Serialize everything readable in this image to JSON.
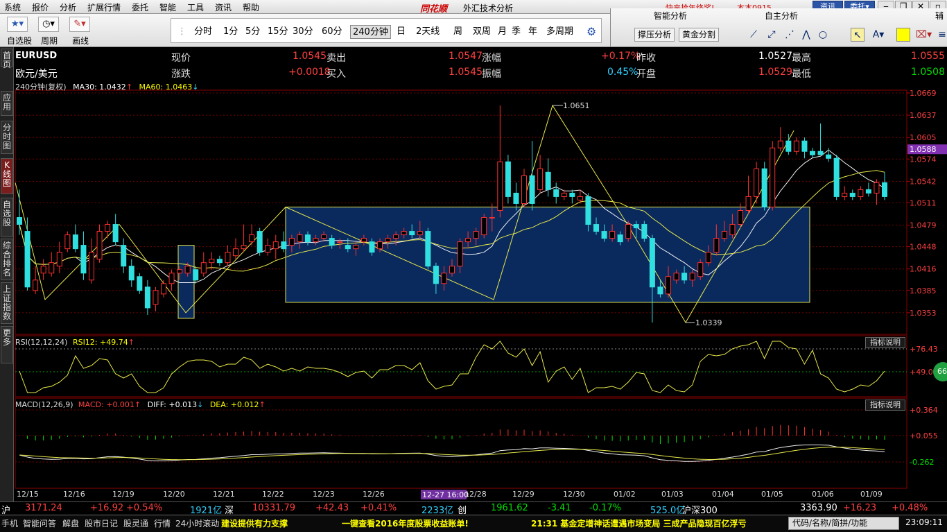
{
  "menu": [
    "系统",
    "报价",
    "分析",
    "扩展行情",
    "委托",
    "智能",
    "工具",
    "资讯",
    "帮助"
  ],
  "brand": "同花顺",
  "app_title": "外汇技术分析",
  "promo": "快来拾年终奖!",
  "user": "本本0915",
  "top_buttons": {
    "news": "资讯",
    "trade": "委托▾"
  },
  "toolbar": {
    "selfselect": "自选股",
    "period": "周期",
    "draw": "画线"
  },
  "periods": [
    "分时",
    "1分",
    "5分",
    "15分",
    "30分",
    "60分",
    "240分钟",
    "日",
    "2天线",
    "周",
    "双周",
    "月",
    "季",
    "年",
    "多周期"
  ],
  "active_period": "240分钟",
  "right_panel": {
    "smart": "智能分析",
    "self": "自主分析",
    "assist": "辅",
    "support": "撑压分析",
    "golden": "黄金分割"
  },
  "sidebar": [
    "首页",
    "应用",
    "分时图",
    "K线图",
    "自选股",
    "综合排名",
    "上证指数",
    "更多"
  ],
  "quote": {
    "code": "EURUSD",
    "name": "欧元/美元",
    "price_label": "现价",
    "price": "1.0545",
    "sell_label": "卖出",
    "sell": "1.0547",
    "pct_label": "涨幅",
    "pct": "+0.17%",
    "prevclose_label": "昨收",
    "prevclose": "1.0527",
    "high_label": "最高",
    "high": "1.0555",
    "change_label": "涨跌",
    "change": "+0.0018",
    "buy_label": "买入",
    "buy": "1.0545",
    "amp_label": "振幅",
    "amp": "0.45%",
    "open_label": "开盘",
    "open": "1.0529",
    "low_label": "最低",
    "low": "1.0508"
  },
  "ma_line": {
    "period": "240分钟(复权)",
    "ma30": "MA30: 1.0432",
    "ma60": "MA60: 1.0463"
  },
  "rsi_line": {
    "name": "RSI(12,12,24)",
    "val": "RSI12: +49.74"
  },
  "macd_line": {
    "name": "MACD(12,26,9)",
    "macd": "MACD: +0.001",
    "diff": "DIFF: +0.013",
    "dea": "DEA: +0.012"
  },
  "indicator_btn": "指标说明",
  "rsi_badge": "66",
  "chart_data": {
    "type": "candlestick",
    "price_axis": [
      "1.0669",
      "1.0637",
      "1.0605",
      "1.0574",
      "1.0542",
      "1.0511",
      "1.0479",
      "1.0448",
      "1.0416",
      "1.0385",
      "1.0353"
    ],
    "current_price": "1.0588",
    "annotations": {
      "high": "1.0651",
      "low": "1.0339"
    },
    "ylim": [
      1.0322,
      1.0669
    ],
    "rsi_axis": [
      "76.43",
      "49.02"
    ],
    "macd_axis": [
      "0.364",
      "0.055",
      "-0.262"
    ],
    "dates": [
      "12/15",
      "12/16",
      "12/19",
      "12/20",
      "12/21",
      "12/22",
      "12/23",
      "12/26",
      "12/28",
      "12/29",
      "12/30",
      "01/02",
      "01/03",
      "01/04",
      "01/05",
      "01/06",
      "01/09"
    ],
    "cursor_date": "12-27 16:00",
    "candles": [
      [
        1.049,
        1.048,
        1.053,
        1.0465
      ],
      [
        1.047,
        1.039,
        1.049,
        1.0385
      ],
      [
        1.0385,
        1.04,
        1.042,
        1.038
      ],
      [
        1.041,
        1.042,
        1.043,
        1.04
      ],
      [
        1.041,
        1.0425,
        1.044,
        1.0405
      ],
      [
        1.042,
        1.044,
        1.0455,
        1.041
      ],
      [
        1.0445,
        1.0465,
        1.047,
        1.044
      ],
      [
        1.0465,
        1.0445,
        1.048,
        1.044
      ],
      [
        1.045,
        1.041,
        1.047,
        1.04
      ],
      [
        1.04,
        1.044,
        1.046,
        1.0395
      ],
      [
        1.043,
        1.047,
        1.048,
        1.0425
      ],
      [
        1.047,
        1.048,
        1.0485,
        1.046
      ],
      [
        1.048,
        1.0455,
        1.0495,
        1.045
      ],
      [
        1.045,
        1.042,
        1.046,
        1.041
      ],
      [
        1.042,
        1.04,
        1.043,
        1.039
      ],
      [
        1.0405,
        1.0385,
        1.041,
        1.038
      ],
      [
        1.039,
        1.036,
        1.04,
        1.035
      ],
      [
        1.0365,
        1.0385,
        1.039,
        1.0355
      ],
      [
        1.038,
        1.0395,
        1.04,
        1.0375
      ],
      [
        1.0395,
        1.041,
        1.0415,
        1.0385
      ],
      [
        1.041,
        1.0415,
        1.042,
        1.04
      ],
      [
        1.041,
        1.042,
        1.0425,
        1.0405
      ],
      [
        1.0415,
        1.04,
        1.042,
        1.0395
      ],
      [
        1.041,
        1.0425,
        1.044,
        1.0405
      ],
      [
        1.0425,
        1.043,
        1.044,
        1.0415
      ],
      [
        1.043,
        1.0425,
        1.0435,
        1.042
      ],
      [
        1.0425,
        1.044,
        1.045,
        1.042
      ],
      [
        1.0435,
        1.0445,
        1.046,
        1.043
      ],
      [
        1.0445,
        1.045,
        1.048,
        1.044
      ],
      [
        1.0455,
        1.0465,
        1.048,
        1.045
      ],
      [
        1.047,
        1.044,
        1.0475,
        1.0435
      ],
      [
        1.044,
        1.045,
        1.046,
        1.0435
      ],
      [
        1.0445,
        1.0455,
        1.0465,
        1.043
      ],
      [
        1.0455,
        1.0445,
        1.047,
        1.044
      ],
      [
        1.045,
        1.046,
        1.0465,
        1.044
      ],
      [
        1.0455,
        1.0465,
        1.047,
        1.0445
      ],
      [
        1.0465,
        1.0455,
        1.047,
        1.045
      ],
      [
        1.0455,
        1.046,
        1.0465,
        1.045
      ],
      [
        1.046,
        1.0465,
        1.047,
        1.0455
      ],
      [
        1.046,
        1.045,
        1.0465,
        1.0445
      ],
      [
        1.0455,
        1.0455,
        1.046,
        1.0445
      ],
      [
        1.045,
        1.0445,
        1.046,
        1.044
      ],
      [
        1.0445,
        1.045,
        1.0455,
        1.0435
      ],
      [
        1.0455,
        1.046,
        1.0465,
        1.045
      ],
      [
        1.0455,
        1.044,
        1.046,
        1.0435
      ],
      [
        1.0445,
        1.0455,
        1.046,
        1.044
      ],
      [
        1.0455,
        1.046,
        1.0465,
        1.0445
      ],
      [
        1.046,
        1.0465,
        1.047,
        1.045
      ],
      [
        1.0465,
        1.047,
        1.0475,
        1.046
      ],
      [
        1.047,
        1.0465,
        1.048,
        1.046
      ],
      [
        1.0465,
        1.047,
        1.0485,
        1.046
      ],
      [
        1.047,
        1.042,
        1.0475,
        1.0415
      ],
      [
        1.042,
        1.0395,
        1.0425,
        1.038
      ],
      [
        1.0395,
        1.041,
        1.042,
        1.0385
      ],
      [
        1.041,
        1.042,
        1.043,
        1.0405
      ],
      [
        1.042,
        1.0455,
        1.046,
        1.041
      ],
      [
        1.0455,
        1.046,
        1.047,
        1.0445
      ],
      [
        1.046,
        1.047,
        1.0475,
        1.045
      ],
      [
        1.0465,
        1.049,
        1.0495,
        1.046
      ],
      [
        1.049,
        1.049,
        1.051,
        1.047
      ],
      [
        1.05,
        1.057,
        1.0651,
        1.049
      ],
      [
        1.057,
        1.052,
        1.058,
        1.051
      ],
      [
        1.0525,
        1.051,
        1.054,
        1.05
      ],
      [
        1.051,
        1.055,
        1.056,
        1.0505
      ],
      [
        1.055,
        1.051,
        1.06,
        1.05
      ],
      [
        1.053,
        1.056,
        1.058,
        1.0525
      ],
      [
        1.0555,
        1.053,
        1.0575,
        1.052
      ],
      [
        1.053,
        1.052,
        1.054,
        1.051
      ],
      [
        1.052,
        1.0525,
        1.053,
        1.0515
      ],
      [
        1.0525,
        1.052,
        1.053,
        1.051
      ],
      [
        1.0515,
        1.052,
        1.053,
        1.051
      ],
      [
        1.052,
        1.048,
        1.0525,
        1.047
      ],
      [
        1.048,
        1.047,
        1.049,
        1.0465
      ],
      [
        1.047,
        1.046,
        1.048,
        1.0455
      ],
      [
        1.046,
        1.047,
        1.048,
        1.0455
      ],
      [
        1.0465,
        1.0455,
        1.047,
        1.045
      ],
      [
        1.046,
        1.048,
        1.0485,
        1.0455
      ],
      [
        1.048,
        1.0475,
        1.0485,
        1.046
      ],
      [
        1.048,
        1.046,
        1.0485,
        1.0455
      ],
      [
        1.046,
        1.039,
        1.0465,
        1.0339
      ],
      [
        1.039,
        1.038,
        1.04,
        1.0375
      ],
      [
        1.038,
        1.0405,
        1.042,
        1.0375
      ],
      [
        1.04,
        1.041,
        1.0415,
        1.0395
      ],
      [
        1.041,
        1.04,
        1.042,
        1.0395
      ],
      [
        1.04,
        1.041,
        1.0415,
        1.039
      ],
      [
        1.0405,
        1.0425,
        1.043,
        1.04
      ],
      [
        1.0425,
        1.044,
        1.045,
        1.042
      ],
      [
        1.044,
        1.046,
        1.048,
        1.0435
      ],
      [
        1.046,
        1.047,
        1.0485,
        1.0455
      ],
      [
        1.0465,
        1.048,
        1.0495,
        1.046
      ],
      [
        1.048,
        1.05,
        1.051,
        1.0475
      ],
      [
        1.05,
        1.052,
        1.055,
        1.0495
      ],
      [
        1.052,
        1.056,
        1.057,
        1.051
      ],
      [
        1.056,
        1.0505,
        1.057,
        1.05
      ],
      [
        1.0505,
        1.059,
        1.06,
        1.05
      ],
      [
        1.059,
        1.06,
        1.062,
        1.0585
      ],
      [
        1.06,
        1.0585,
        1.061,
        1.058
      ],
      [
        1.0585,
        1.06,
        1.0605,
        1.058
      ],
      [
        1.06,
        1.0585,
        1.0605,
        1.0575
      ],
      [
        1.0585,
        1.058,
        1.059,
        1.0575
      ],
      [
        1.0585,
        1.058,
        1.0625,
        1.058
      ],
      [
        1.058,
        1.0575,
        1.059,
        1.057
      ],
      [
        1.0575,
        1.052,
        1.058,
        1.0515
      ],
      [
        1.052,
        1.0525,
        1.0535,
        1.0515
      ],
      [
        1.0525,
        1.052,
        1.053,
        1.0515
      ],
      [
        1.052,
        1.053,
        1.0535,
        1.0515
      ],
      [
        1.053,
        1.0525,
        1.054,
        1.052
      ],
      [
        1.0525,
        1.054,
        1.0545,
        1.0508
      ],
      [
        1.054,
        1.052,
        1.0555,
        1.0515
      ]
    ]
  },
  "status": {
    "sh_label": "沪",
    "sh": "3171.24",
    "sh_chg": "+16.92",
    "sh_pct": "+0.54%",
    "sh_amt": "1921亿",
    "sz_label": "深",
    "sz": "10331.79",
    "sz_chg": "+42.43",
    "sz_pct": "+0.41%",
    "cy_amt": "2233亿",
    "cy_label": "创",
    "cy": "1961.62",
    "cy_chg": "-3.41",
    "cy_pct": "-0.17%",
    "hs_amt": "525.0亿",
    "hs_label": "沪深300",
    "hs": "3363.90",
    "hs_chg": "+16.23",
    "hs_pct": "+0.48%"
  },
  "taskbar": {
    "items": [
      "手机",
      "智能问答",
      "解盘",
      "股市日记",
      "股灵通",
      "行情",
      "24小时滚动"
    ],
    "ticker1": "建设提供有力支撑",
    "ticker2": "一键查看2016年度股票收益账单!",
    "ticker3": "21:31 基金定增神话遭遇市场变局 三成产品隐现百亿浮亏",
    "search": "代码/名称/简拼/功能",
    "clock": "23:09:11"
  }
}
